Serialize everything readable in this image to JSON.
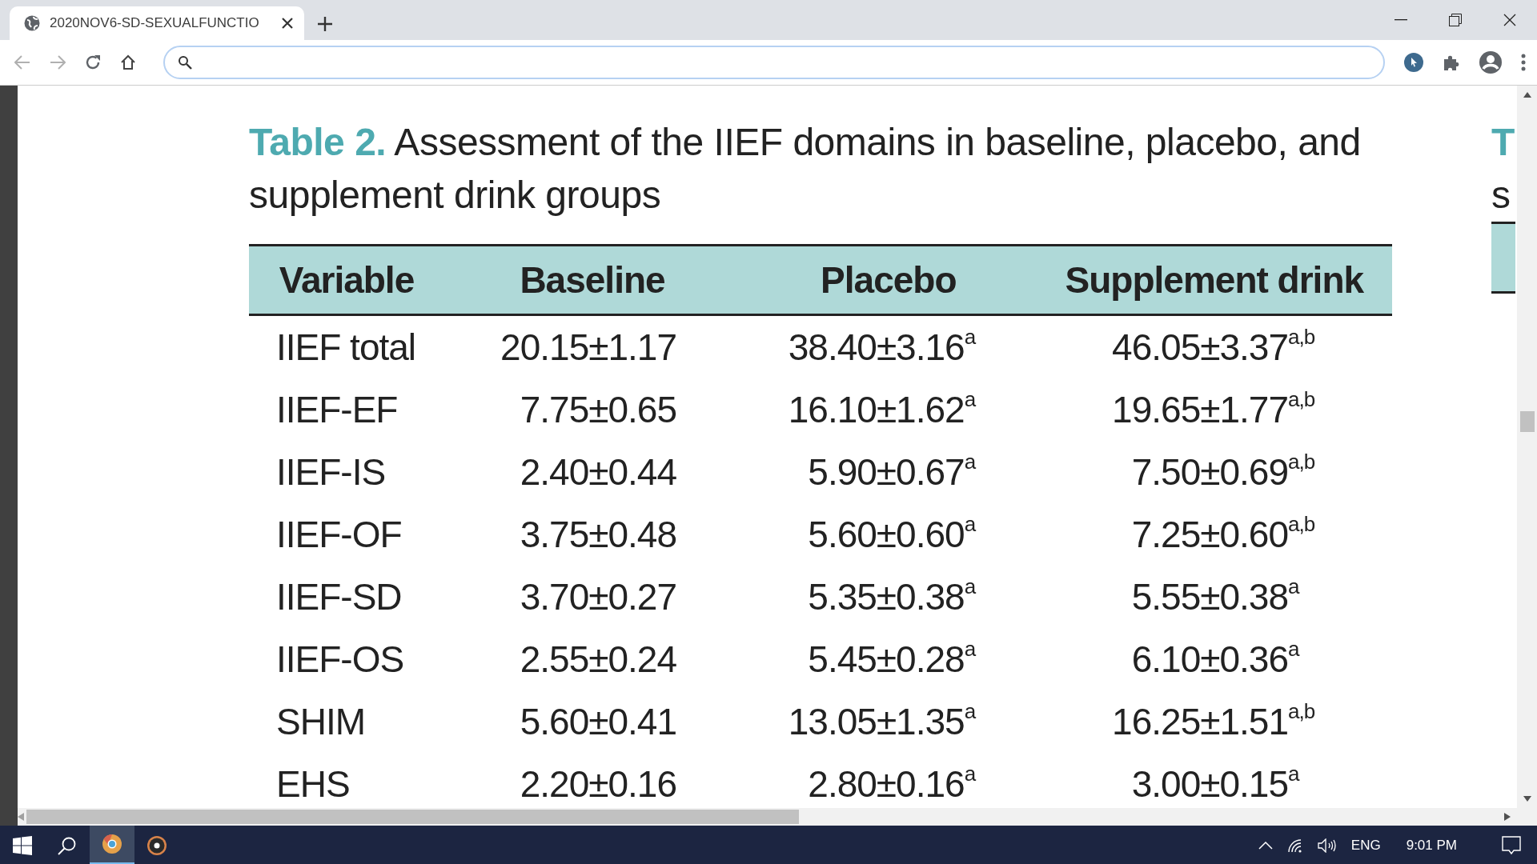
{
  "browser": {
    "tab": {
      "title": "2020NOV6-SD-SEXUALFUNCTIO",
      "selected": true
    }
  },
  "document": {
    "table_label": "Table 2.",
    "table_title": "Assessment of the IIEF domains in baseline, placebo, and supplement drink groups",
    "table": {
      "columns": [
        "Variable",
        "Baseline",
        "Placebo",
        "Supplement drink"
      ],
      "rows": [
        {
          "variable": "IIEF total",
          "baseline": "20.15±1.17",
          "placebo": "38.40±3.16$^{a}$",
          "supplement": "46.05±3.37$^{a,b}$"
        },
        {
          "variable": "IIEF-EF",
          "baseline": "7.75±0.65",
          "placebo": "16.10±1.62$^{a}$",
          "supplement": "19.65±1.77$^{a,b}$"
        },
        {
          "variable": "IIEF-IS",
          "baseline": "2.40±0.44",
          "placebo": "5.90±0.67$^{a}$",
          "supplement": "7.50±0.69$^{a,b}$"
        },
        {
          "variable": "IIEF-OF",
          "baseline": "3.75±0.48",
          "placebo": "5.60±0.60$^{a}$",
          "supplement": "7.25±0.60$^{a,b}$"
        },
        {
          "variable": "IIEF-SD",
          "baseline": "3.70±0.27",
          "placebo": "5.35±0.38$^{a}$",
          "supplement": "5.55±0.38$^{a}$"
        },
        {
          "variable": "IIEF-OS",
          "baseline": "2.55±0.24",
          "placebo": "5.45±0.28$^{a}$",
          "supplement": "6.10±0.36$^{a}$"
        },
        {
          "variable": "SHIM",
          "baseline": "5.60±0.41",
          "placebo": "13.05±1.35$^{a}$",
          "supplement": "16.25±1.51$^{a,b}$"
        },
        {
          "variable": "EHS",
          "baseline": "2.20±0.16",
          "placebo": "2.80±0.16$^{a}$",
          "supplement": "3.00±0.15$^{a}$"
        }
      ]
    },
    "next_table": {
      "label": "T",
      "title": "s"
    }
  },
  "taskbar": {
    "language": "ENG",
    "time": "9:01 PM"
  }
}
